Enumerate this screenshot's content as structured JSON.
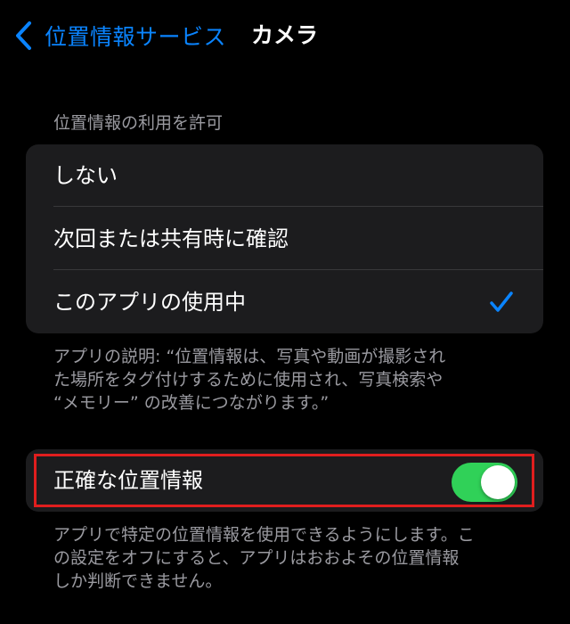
{
  "nav": {
    "back_label": "位置情報サービス",
    "back_icon": "chevron-left-icon",
    "title": "カメラ"
  },
  "section": {
    "header": "位置情報の利用を許可",
    "options": [
      {
        "label": "しない",
        "selected": false
      },
      {
        "label": "次回または共有時に確認",
        "selected": false
      },
      {
        "label": "このアプリの使用中",
        "selected": true
      }
    ],
    "footer_lines": [
      "アプリの説明: “位置情報は、写真や動画が撮影され",
      "た場所をタグ付けするために使用され、写真検索や",
      "“メモリー” の改善につながります。”"
    ]
  },
  "precise": {
    "label": "正確な位置情報",
    "enabled": true,
    "footer_lines": [
      "アプリで特定の位置情報を使用できるようにします。こ",
      "の設定をオフにすると、アプリはおおよその位置情報",
      "しか判断できません。"
    ]
  },
  "colors": {
    "accent": "#0a84ff",
    "toggle_on": "#30d158",
    "highlight_border": "#e01e1e",
    "group_background": "#1c1c1e",
    "background": "#000000"
  }
}
